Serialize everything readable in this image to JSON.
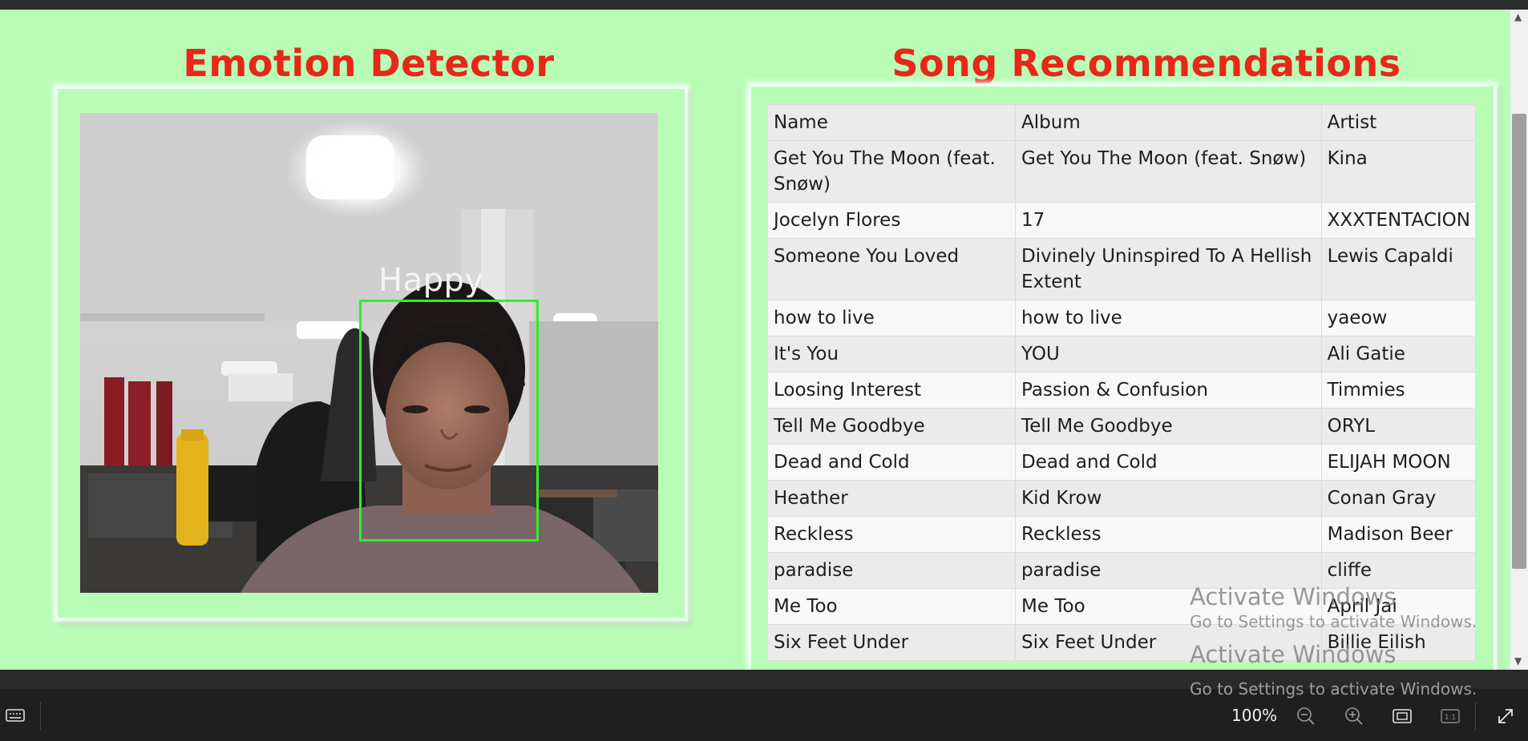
{
  "headings": {
    "left": "Emotion Detector",
    "right": "Song Recommendations"
  },
  "camera": {
    "emotion": "Happy",
    "box_color": "#2ef02b"
  },
  "table": {
    "headers": [
      "Name",
      "Album",
      "Artist"
    ],
    "rows": [
      [
        "Get You The Moon (feat. Snøw)",
        "Get You The Moon (feat. Snøw)",
        "Kina"
      ],
      [
        "Jocelyn Flores",
        "17",
        "XXXTENTACION"
      ],
      [
        "Someone You Loved",
        "Divinely Uninspired To A Hellish Extent",
        "Lewis Capaldi"
      ],
      [
        "how to live",
        "how to live",
        "yaeow"
      ],
      [
        "It's You",
        "YOU",
        "Ali Gatie"
      ],
      [
        "Loosing Interest",
        "Passion & Confusion",
        "Timmies"
      ],
      [
        "Tell Me Goodbye",
        "Tell Me Goodbye",
        "ORYL"
      ],
      [
        "Dead and Cold",
        "Dead and Cold",
        "ELIJAH MOON"
      ],
      [
        "Heather",
        "Kid Krow",
        "Conan Gray"
      ],
      [
        "Reckless",
        "Reckless",
        "Madison Beer"
      ],
      [
        "paradise",
        "paradise",
        "cliffe"
      ],
      [
        "Me Too",
        "Me Too",
        "April Jai"
      ],
      [
        "Six Feet Under",
        "Six Feet Under",
        "Billie Eilish"
      ]
    ]
  },
  "watermark": {
    "title": "Activate Windows",
    "subtitle": "Go to Settings to activate Windows."
  },
  "viewer": {
    "zoom": "100%",
    "icons": [
      "keyboard-icon",
      "zoom-out-icon",
      "zoom-in-icon",
      "fit-screen-icon",
      "actual-size-icon",
      "expand-icon"
    ]
  },
  "colors": {
    "page_bg": "#b9fcb6",
    "heading": "#e8261a",
    "viewer_bar": "#1f1f1f"
  }
}
